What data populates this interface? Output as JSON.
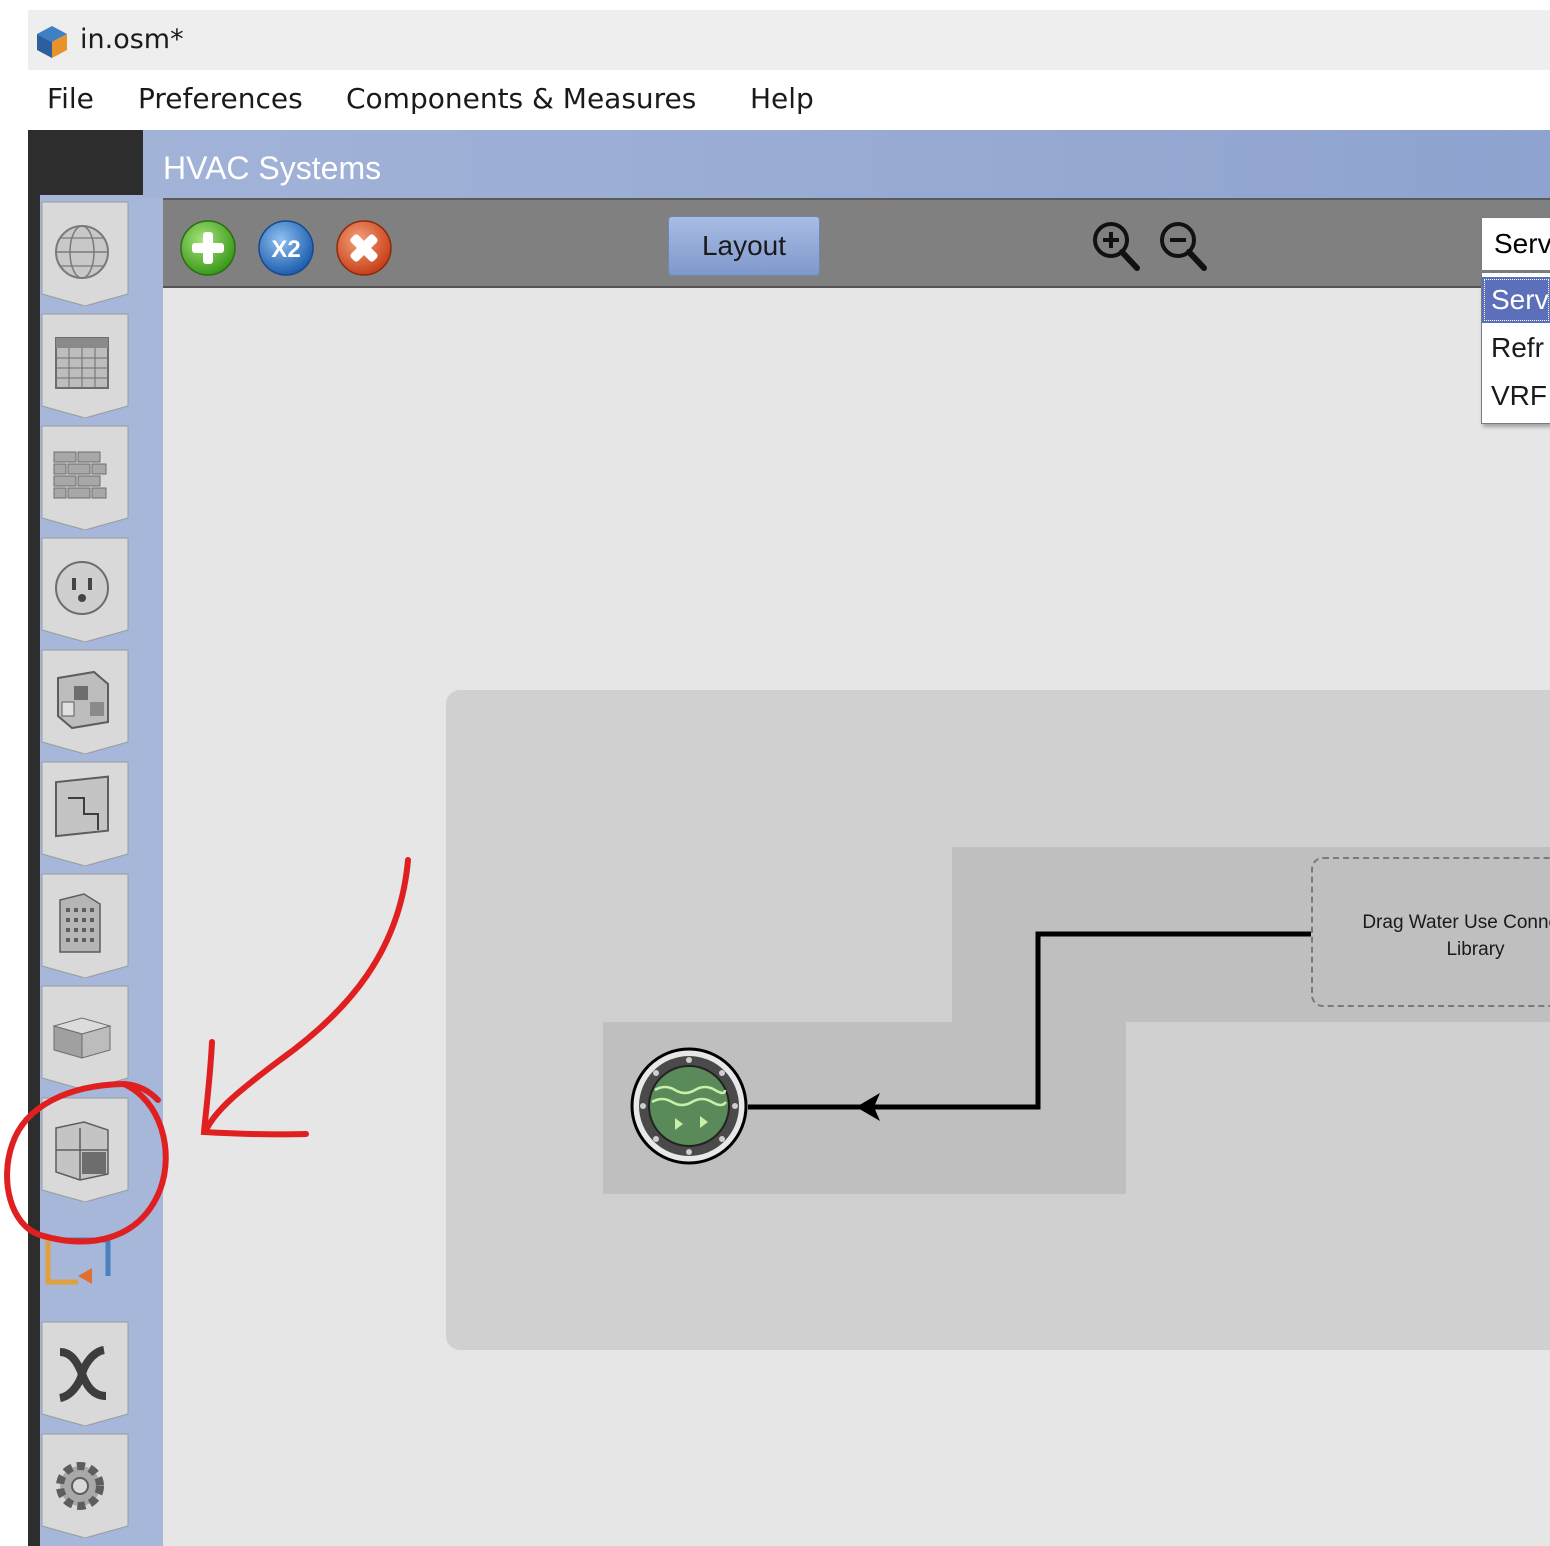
{
  "window": {
    "title": "in.osm*"
  },
  "menu": {
    "items": [
      {
        "label": "File"
      },
      {
        "label": "Preferences"
      },
      {
        "label": "Components & Measures"
      },
      {
        "label": "Help"
      }
    ]
  },
  "sidebar": {
    "tabs": [
      {
        "icon": "globe-icon",
        "label": "Site"
      },
      {
        "icon": "calendar-icon",
        "label": "Schedules"
      },
      {
        "icon": "brick-wall-icon",
        "label": "Constructions"
      },
      {
        "icon": "power-outlet-icon",
        "label": "Loads"
      },
      {
        "icon": "space-types-icon",
        "label": "Space Types"
      },
      {
        "icon": "geometry-icon",
        "label": "Geometry"
      },
      {
        "icon": "building-icon",
        "label": "Facility"
      },
      {
        "icon": "spaces-box-icon",
        "label": "Spaces"
      },
      {
        "icon": "thermal-zones-icon",
        "label": "Thermal Zones"
      },
      {
        "icon": "hvac-systems-icon",
        "label": "HVAC Systems"
      },
      {
        "icon": "variables-icon",
        "label": "Output Variables"
      },
      {
        "icon": "gear-icon",
        "label": "Simulation Settings"
      }
    ],
    "active_index": 9
  },
  "main": {
    "title": "HVAC Systems",
    "toolbar": {
      "add_icon": "add-icon",
      "duplicate_icon": "duplicate-x2-icon",
      "duplicate_label": "X2",
      "delete_icon": "delete-icon",
      "layout_label": "Layout",
      "zoom_in_icon": "zoom-in-icon",
      "zoom_out_icon": "zoom-out-icon",
      "loop_select_value": "Serv"
    },
    "dropdown": {
      "options": [
        "Serv",
        "Refr",
        "VRF"
      ],
      "selected_index": 0
    },
    "canvas": {
      "drop_zone_text_line1": "Drag Water Use Connectio",
      "drop_zone_text_line2": "Library",
      "water_node_icon": "water-heater-icon"
    }
  },
  "annotation": {
    "color": "#e02020",
    "shapes": [
      "arrow",
      "circle"
    ]
  }
}
